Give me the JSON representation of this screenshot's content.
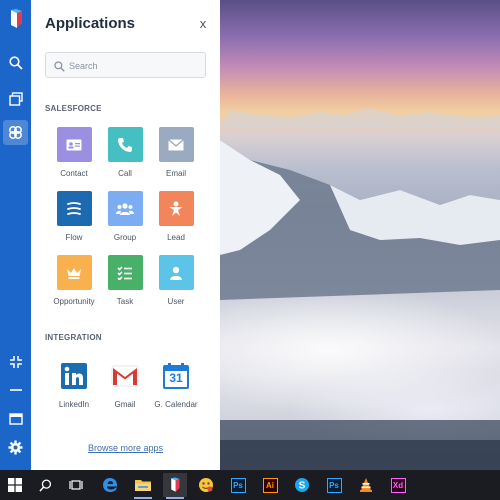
{
  "colors": {
    "rail": "#1d66c9",
    "panel_bg": "#ffffff",
    "taskbar": "#1b1c22",
    "link": "#3f6fb5"
  },
  "rail": {
    "items": [
      {
        "icon": "logo-icon"
      },
      {
        "icon": "search-icon"
      },
      {
        "icon": "windows-stack-icon"
      },
      {
        "icon": "apps-icon",
        "active": true
      },
      {
        "icon": "collapse-icon"
      },
      {
        "icon": "minimize-icon"
      },
      {
        "icon": "window-icon"
      },
      {
        "icon": "gear-icon"
      }
    ]
  },
  "panel": {
    "title": "Applications",
    "close_label": "x",
    "search": {
      "placeholder": "Search",
      "value": ""
    },
    "sections": [
      {
        "label": "SALESFORCE",
        "apps": [
          {
            "label": "Contact",
            "icon": "contact-card-icon",
            "color": "#9a8fe0"
          },
          {
            "label": "Call",
            "icon": "phone-icon",
            "color": "#45bfc2"
          },
          {
            "label": "Email",
            "icon": "envelope-icon",
            "color": "#9aaac0"
          },
          {
            "label": "Flow",
            "icon": "flow-icon",
            "color": "#1d6ab0"
          },
          {
            "label": "Group",
            "icon": "group-icon",
            "color": "#7cacf2"
          },
          {
            "label": "Lead",
            "icon": "lead-icon",
            "color": "#f2865a"
          },
          {
            "label": "Opportunity",
            "icon": "crown-icon",
            "color": "#f8b14e"
          },
          {
            "label": "Task",
            "icon": "task-list-icon",
            "color": "#49b06a"
          },
          {
            "label": "User",
            "icon": "user-icon",
            "color": "#5cc4e6"
          }
        ]
      },
      {
        "label": "INTEGRATION",
        "apps": [
          {
            "label": "LinkedIn",
            "icon": "linkedin-icon"
          },
          {
            "label": "Gmail",
            "icon": "gmail-icon"
          },
          {
            "label": "G. Calendar",
            "icon": "google-calendar-icon",
            "day": "31"
          }
        ]
      }
    ],
    "browse_label": "Browse more apps"
  },
  "taskbar": {
    "items": [
      {
        "icon": "windows-start-icon"
      },
      {
        "icon": "search-icon"
      },
      {
        "icon": "task-view-icon"
      },
      {
        "icon": "edge-icon"
      },
      {
        "icon": "file-explorer-icon",
        "open": true
      },
      {
        "icon": "app-logo-icon",
        "active": true
      },
      {
        "icon": "emoji-app-icon"
      },
      {
        "icon": "photoshop-icon",
        "text": "Ps"
      },
      {
        "icon": "illustrator-icon",
        "text": "Ai"
      },
      {
        "icon": "skype-icon"
      },
      {
        "icon": "photoshop-icon-2",
        "text": "Ps"
      },
      {
        "icon": "vlc-icon"
      },
      {
        "icon": "xd-icon",
        "text": "Xd"
      }
    ]
  }
}
